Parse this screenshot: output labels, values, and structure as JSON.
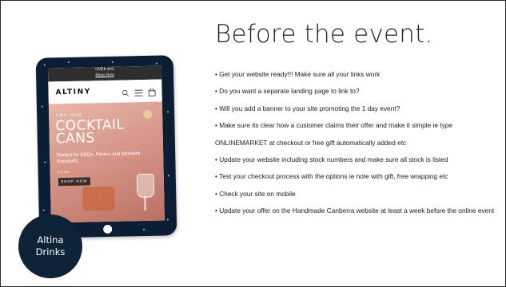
{
  "slide": {
    "title": "Before the event.",
    "bullets": [
      "• Get your website ready!!! Make sure all your links work",
      "• Do you want a separate landing page to link to?",
      "• Will you add a banner to your site promoting the 1 day event?",
      "• Make sure its clear how a customer claims their offer and make it simple ie type ONLINEMARKET at checkout or free gift automatically added etc",
      "• Update your website including stock numbers and make sure all stock is listed",
      "• Test your checkout process with the options ie note with gift, free wrapping etc",
      "• Check your site on mobile",
      "• Update your offer on the Handmade Canberra website at least a week before the online event"
    ],
    "badge": {
      "line1": "Altina",
      "line2": "Drinks"
    }
  },
  "tablet_screen": {
    "announcement_line1": "OVER $85",
    "announcement_link": "Shop Now",
    "logo": "ALTINY",
    "hero_eyebrow": "TRY OUR",
    "hero_headline": "COCKTAIL CANS",
    "hero_subtext": "Perfect for BBQs, Picnics and Midweek Knockoffs",
    "hero_button": "SHOP NOW",
    "small_label": "ALTINY"
  },
  "icons": [
    "search-icon",
    "menu-icon",
    "cart-icon"
  ],
  "colors": {
    "tablet_frame": "#0c1e33",
    "badge_bg": "#0e2337",
    "hero_pink": "#d89a8c"
  }
}
